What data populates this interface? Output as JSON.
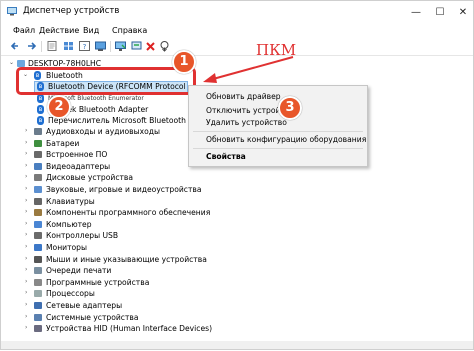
{
  "window": {
    "title": "Диспетчер устройств",
    "minimize_glyph": "—",
    "maximize_glyph": "☐",
    "close_glyph": "✕"
  },
  "menu": [
    "Файл",
    "Действие",
    "Вид",
    "Справка"
  ],
  "toolbar": {
    "icons": [
      "back-arrow-icon",
      "forward-arrow-icon",
      "properties-icon",
      "grid-view-icon",
      "help-icon",
      "device-manager-icon",
      "monitor-icon",
      "remove-device-icon",
      "update-driver-icon"
    ]
  },
  "tree": {
    "root": "DESKTOP-78H0LHC",
    "bluetooth": {
      "label": "Bluetooth",
      "children": [
        "Bluetooth Device (RFCOMM Protocol TDI)",
        "Microsoft Bluetooth Enumerator",
        "Realtek Bluetooth Adapter",
        "Перечислитель Microsoft Bluetooth LE (Майкрософт)"
      ]
    },
    "categories": [
      "Аудиовходы и аудиовыходы",
      "Батареи",
      "Встроенное ПО",
      "Видеоадаптеры",
      "Дисковые устройства",
      "Звуковые, игровые и видеоустройства",
      "Клавиатуры",
      "Компоненты программного обеспечения",
      "Компьютер",
      "Контроллеры USB",
      "Мониторы",
      "Мыши и иные указывающие устройства",
      "Очереди печати",
      "Программные устройства",
      "Процессоры",
      "Сетевые адаптеры",
      "Системные устройства",
      "Устройства HID (Human Interface Devices)"
    ]
  },
  "context_menu": {
    "items": [
      "Обновить драйвер",
      "Отключить устройство",
      "Удалить устройство",
      "Обновить конфигурацию оборудования",
      "Свойства"
    ]
  },
  "annotations": {
    "label": "ПКМ",
    "steps": [
      "1",
      "2",
      "3"
    ],
    "color": "#e03131",
    "badge_color": "#e8562a"
  }
}
